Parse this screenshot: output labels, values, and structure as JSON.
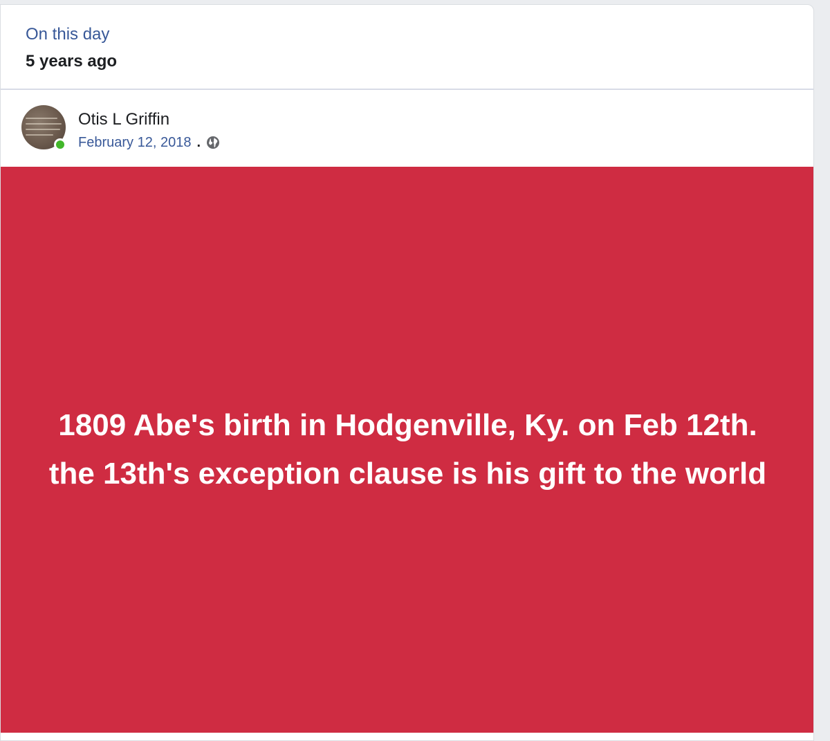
{
  "memories": {
    "title": "On this day",
    "subtitle": "5 years ago"
  },
  "post": {
    "author": "Otis L Griffin",
    "date": "February 12, 2018",
    "separator": ".",
    "privacy_icon": "globe-icon",
    "online_status": "online",
    "body_text": "1809 Abe's birth in Hodgenville, Ky. on Feb 12th. the 13th's exception clause is his gift to the world",
    "background_color": "#cf2c42",
    "text_color": "#ffffff"
  },
  "colors": {
    "link": "#385898",
    "online": "#42b72a"
  }
}
